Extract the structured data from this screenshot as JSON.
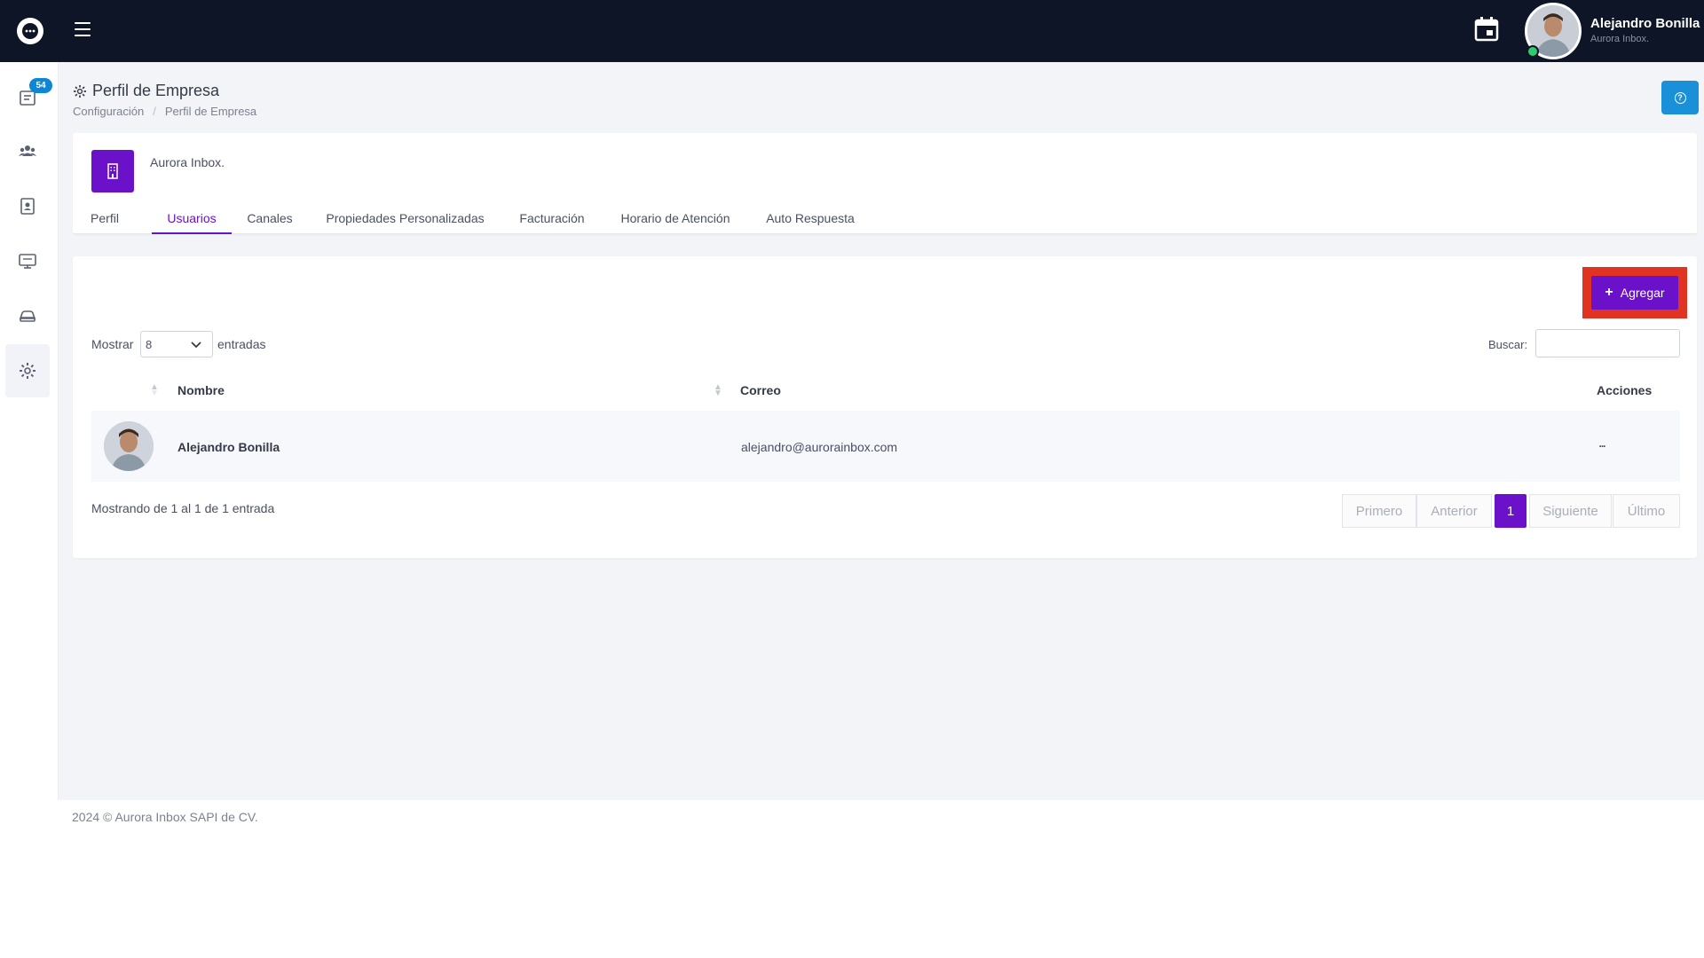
{
  "topbar": {
    "logo_icon": "chat-bubble-icon",
    "menu_icon": "hamburger-icon",
    "calendar_icon": "calendar-icon",
    "user_name": "Alejandro Bonilla",
    "user_subtitle": "Aurora Inbox."
  },
  "sidebar": {
    "badge": "54",
    "items": [
      {
        "name": "inbox",
        "icon": "inbox-icon"
      },
      {
        "name": "contacts",
        "icon": "users-icon"
      },
      {
        "name": "directory",
        "icon": "contact-card-icon"
      },
      {
        "name": "broadcasts",
        "icon": "monitor-icon"
      },
      {
        "name": "automation",
        "icon": "car-icon"
      },
      {
        "name": "settings",
        "icon": "gear-icon"
      }
    ]
  },
  "header": {
    "title": "Perfil de Empresa",
    "breadcrumb": [
      "Configuración",
      "Perfil de Empresa"
    ],
    "help_icon": "help-icon"
  },
  "company": {
    "name": "Aurora Inbox.",
    "logo_icon": "building-icon",
    "tabs": [
      {
        "label": "Perfil",
        "active": false
      },
      {
        "label": "Usuarios",
        "active": true
      },
      {
        "label": "Canales",
        "active": false
      },
      {
        "label": "Propiedades Personalizadas",
        "active": false
      },
      {
        "label": "Facturación",
        "active": false
      },
      {
        "label": "Horario de Atención",
        "active": false
      },
      {
        "label": "Auto Respuesta",
        "active": false
      }
    ]
  },
  "users": {
    "add_label": "Agregar",
    "show_label": "Mostrar",
    "show_value": "8",
    "entries_label": "entradas",
    "search_label": "Buscar:",
    "search_value": "",
    "columns": {
      "name": "Nombre",
      "email": "Correo",
      "actions": "Acciones"
    },
    "rows": [
      {
        "name": "Alejandro Bonilla",
        "email": "alejandro@aurorainbox.com",
        "actions": "..."
      }
    ],
    "showing_text": "Mostrando de 1 al 1 de 1 entrada",
    "pagination": {
      "first": "Primero",
      "prev": "Anterior",
      "current": "1",
      "next": "Siguiente",
      "last": "Último"
    }
  },
  "footer": {
    "text": "2024 © Aurora Inbox SAPI de CV."
  },
  "colors": {
    "topbar": "#0d1526",
    "accent": "#6a11c9",
    "help": "#1a90d8",
    "highlight": "#e03321",
    "badge": "#0d86d6",
    "online": "#2ecc71"
  }
}
